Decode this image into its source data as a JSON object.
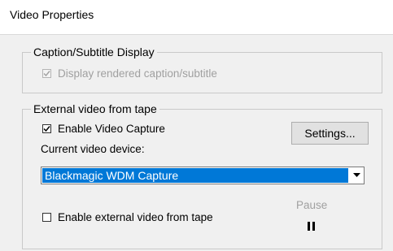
{
  "window": {
    "title": "Video Properties"
  },
  "caption_group": {
    "legend": "Caption/Subtitle Display",
    "display_rendered": {
      "label": "Display rendered caption/subtitle",
      "checked": true,
      "mark": "☑"
    }
  },
  "tape_group": {
    "legend": "External video from tape",
    "enable_capture": {
      "label": "Enable Video Capture",
      "checked": true,
      "mark": "✓"
    },
    "settings_button": "Settings...",
    "device_label": "Current video device:",
    "device_select": {
      "value": "Blackmagic WDM Capture"
    },
    "enable_external": {
      "label": "Enable external video from tape",
      "checked": false,
      "mark": ""
    },
    "pause_label": "Pause"
  },
  "icons": {
    "combo_arrow": "chevron-down-icon",
    "pause": "pause-icon"
  },
  "colors": {
    "selection": "#0078d7",
    "panel": "#f0f0f0"
  }
}
